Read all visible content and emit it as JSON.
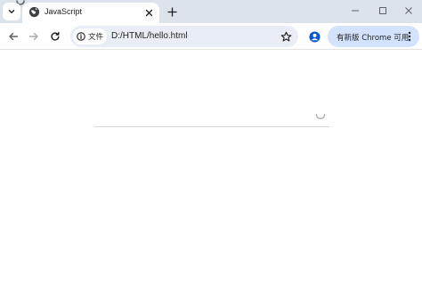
{
  "tab": {
    "title": "JavaScript"
  },
  "omnibox": {
    "security_label": "文件",
    "url": "D:/HTML/hello.html"
  },
  "update_chip": {
    "label": "有新版 Chrome 可用"
  },
  "icons": {
    "tab_search": "chevron-down-icon",
    "favicon": "globe-icon",
    "tab_close": "close-icon",
    "new_tab": "plus-icon",
    "minimize": "minimize-icon",
    "maximize": "maximize-icon",
    "close_window": "close-icon",
    "back": "arrow-left-icon",
    "forward": "arrow-right-icon",
    "reload": "reload-icon",
    "site_info": "info-icon",
    "bookmark": "star-icon",
    "profile": "person-icon",
    "menu": "kebab-menu-icon"
  },
  "colors": {
    "tabstrip_bg": "#dde3ea",
    "omnibox_bg": "#e9eef6",
    "update_chip_bg": "#d3e3fd",
    "profile_blue": "#0b57d0"
  }
}
